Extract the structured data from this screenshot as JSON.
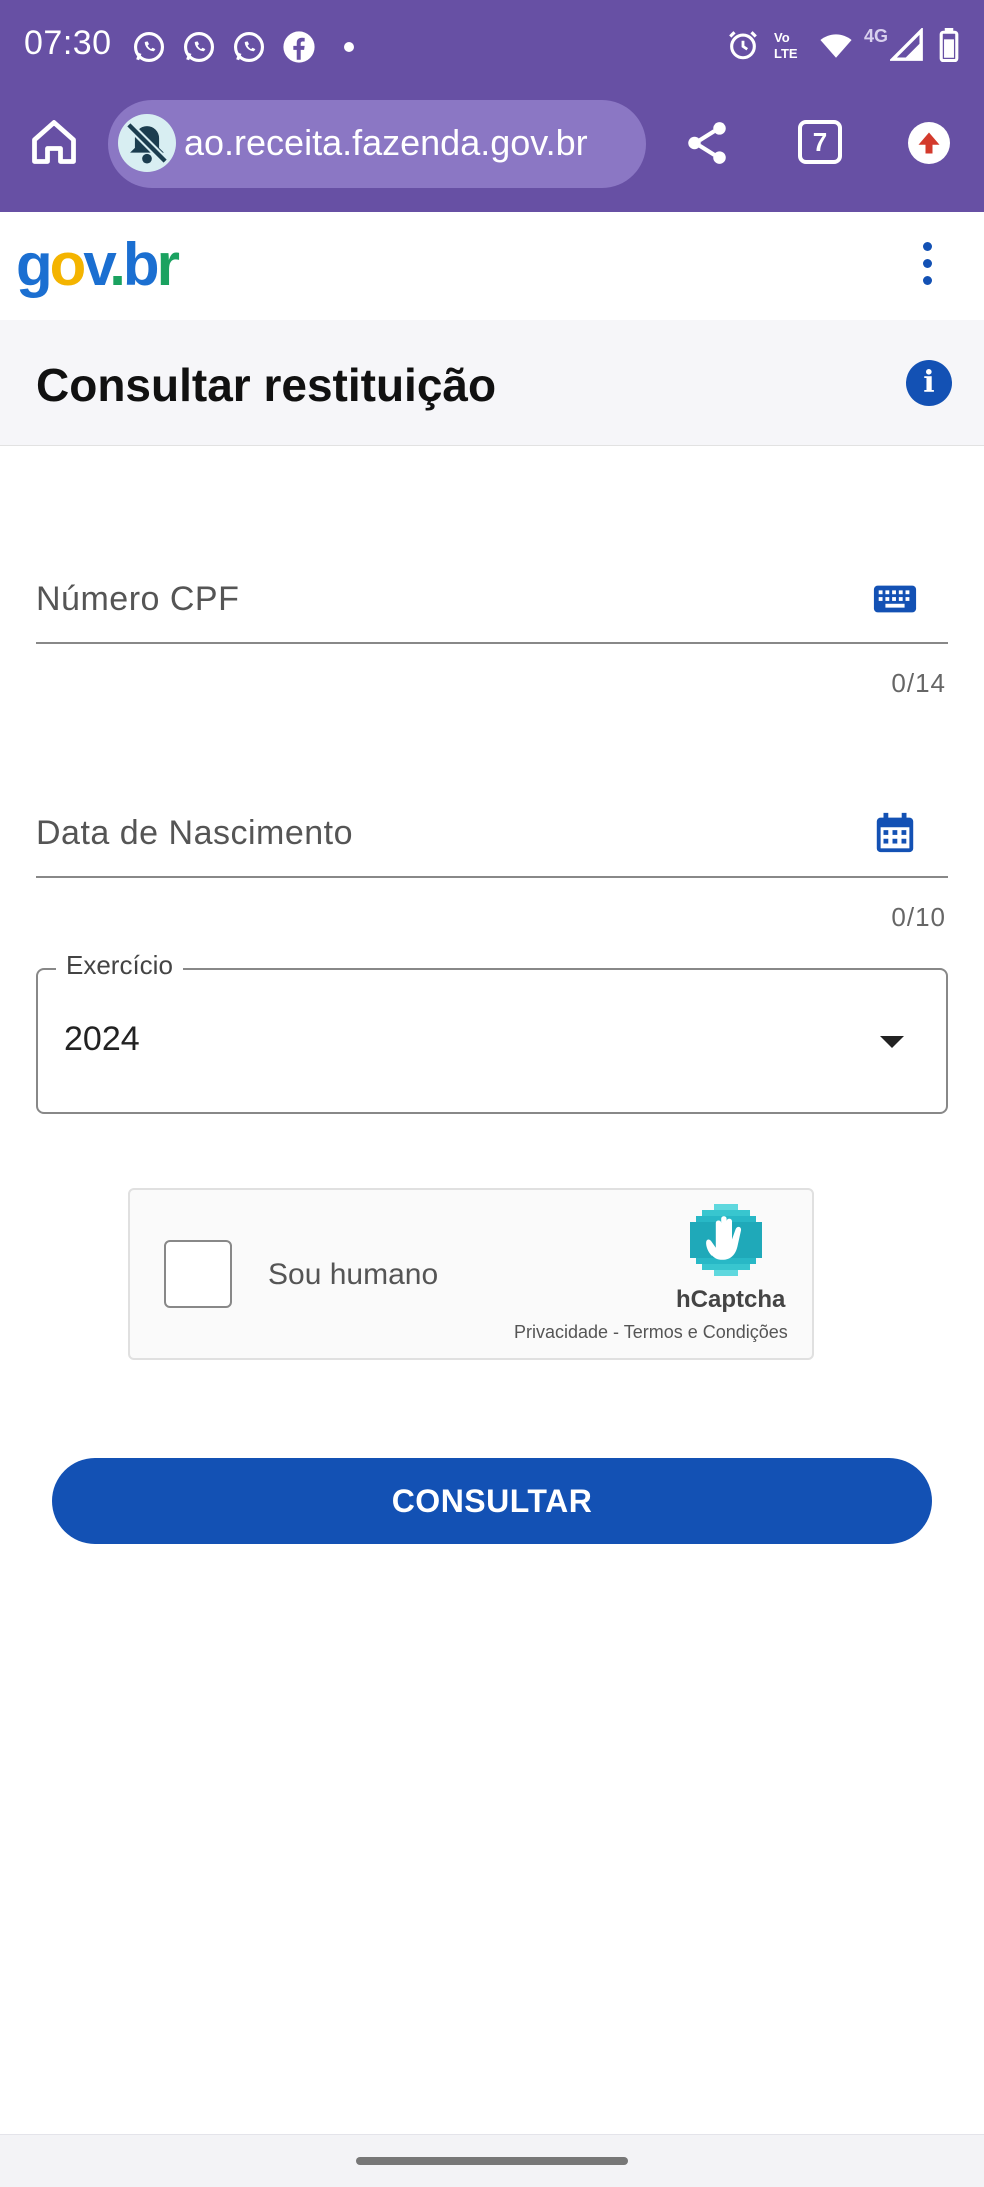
{
  "status_bar": {
    "time": "07:30",
    "notification_icons": [
      "whatsapp-icon",
      "whatsapp-icon",
      "whatsapp-icon",
      "facebook-icon"
    ],
    "right_icons": [
      "alarm-icon",
      "volte-icon",
      "wifi-icon",
      "signal-icon",
      "battery-icon"
    ],
    "network_label": "4G",
    "volte_label": "Vo LTE"
  },
  "browser": {
    "url": "ao.receita.fazenda.gov.br",
    "tab_count": "7"
  },
  "header": {
    "logo_text": "gov.br"
  },
  "page": {
    "title": "Consultar restituição"
  },
  "form": {
    "cpf": {
      "placeholder": "Número CPF",
      "counter": "0/14"
    },
    "birth_date": {
      "placeholder": "Data de Nascimento",
      "counter": "0/10"
    },
    "exercise": {
      "label": "Exercício",
      "value": "2024"
    }
  },
  "captcha": {
    "label": "Sou humano",
    "brand": "hCaptcha",
    "links": "Privacidade - Termos e Condições"
  },
  "actions": {
    "submit_label": "CONSULTAR"
  },
  "colors": {
    "chrome": "#6750a4",
    "primary": "#1351b4",
    "title_bg": "#f6f6f9"
  }
}
